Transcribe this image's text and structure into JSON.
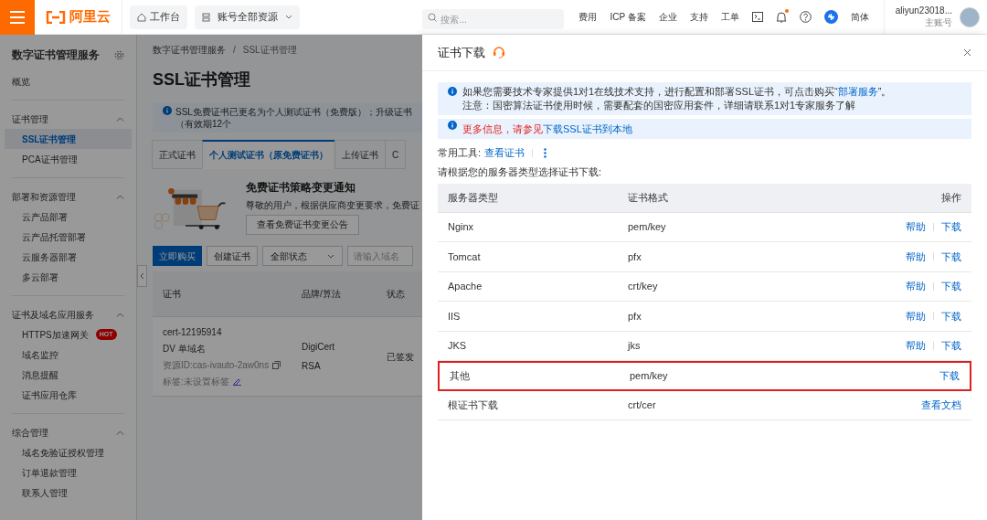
{
  "topbar": {
    "logo": "阿里云",
    "workbench": "工作台",
    "resources": "账号全部资源",
    "search": {
      "placeholder": "搜索..."
    },
    "links": [
      "费用",
      "ICP 备案",
      "企业",
      "支持",
      "工单"
    ],
    "bell_unread": true,
    "language": "简体",
    "user": {
      "name": "aliyun23018...",
      "role": "主账号"
    }
  },
  "sidebar": {
    "title": "数字证书管理服务",
    "items": [
      {
        "label": "概览",
        "selected": false
      }
    ],
    "groups": [
      {
        "label": "证书管理",
        "expanded": true,
        "children": [
          {
            "label": "SSL证书管理",
            "selected": true
          },
          {
            "label": "PCA证书管理",
            "selected": false
          }
        ]
      },
      {
        "label": "部署和资源管理",
        "expanded": true,
        "children": [
          {
            "label": "云产品部署",
            "selected": false
          },
          {
            "label": "云产品托管部署",
            "selected": false
          },
          {
            "label": "云服务器部署",
            "selected": false
          },
          {
            "label": "多云部署",
            "selected": false
          }
        ]
      },
      {
        "label": "证书及域名应用服务",
        "expanded": true,
        "children": [
          {
            "label": "HTTPS加速网关",
            "selected": false,
            "badge": "HOT"
          },
          {
            "label": "域名监控",
            "selected": false
          },
          {
            "label": "消息提醒",
            "selected": false
          },
          {
            "label": "证书应用仓库",
            "selected": false
          }
        ]
      },
      {
        "label": "综合管理",
        "expanded": true,
        "children": [
          {
            "label": "域名免验证授权管理",
            "selected": false
          },
          {
            "label": "订单退款管理",
            "selected": false
          },
          {
            "label": "联系人管理",
            "selected": false
          }
        ]
      }
    ]
  },
  "main": {
    "breadcrumb": [
      "数字证书管理服务",
      "SSL证书管理"
    ],
    "breadcrumb_separator": "/",
    "title": "SSL证书管理",
    "notice": "SSL免费证书已更名为个人测试证书（免费版）；升级证书（有效期12个",
    "tabs": [
      {
        "label": "正式证书",
        "selected": false
      },
      {
        "label": "个人测试证书（原免费证书）",
        "selected": true
      },
      {
        "label": "上传证书",
        "selected": false
      },
      {
        "label": "C",
        "selected": false
      }
    ],
    "promo": {
      "title": "免费证书策略变更通知",
      "text": "尊敬的用户，根据供应商变更要求，免费证",
      "button": "查看免费证书变更公告"
    },
    "toolbar": {
      "buy": "立即购买",
      "create": "创建证书",
      "status": "全部状态",
      "domain_placeholder": "请输入域名"
    },
    "table": {
      "columns": [
        "证书",
        "品牌/算法",
        "状态"
      ],
      "rows": [
        {
          "name": "cert-12195914",
          "type": "DV 单域名",
          "resource": "资源ID:cas-ivauto-2aw0ns",
          "tags": "标签:未设置标签",
          "brand": "DigiCert",
          "algorithm": "RSA",
          "status": "已签发"
        }
      ]
    }
  },
  "drawer": {
    "title": "证书下载",
    "info": [
      {
        "before": "如果您需要技术专家提供1对1在线技术支持，进行配置和部署SSL证书，可点击购买“",
        "link": "部署服务",
        "after": "”。"
      },
      {
        "before": "注意：国密算法证书使用时候，需要配套的国密应用套件，详细请联系1对1专家服务了解"
      }
    ],
    "more": {
      "before": "更多信息，请参见",
      "link": "下载SSL证书到本地"
    },
    "tools": {
      "label": "常用工具:",
      "link": "查看证书"
    },
    "instruction": "请根据您的服务器类型选择证书下载:",
    "table": {
      "columns": [
        "服务器类型",
        "证书格式",
        "操作"
      ],
      "rows": [
        {
          "server": "Nginx",
          "format": "pem/key",
          "actions": [
            "帮助",
            "下载"
          ],
          "highlighted": false
        },
        {
          "server": "Tomcat",
          "format": "pfx",
          "actions": [
            "帮助",
            "下载"
          ],
          "highlighted": false
        },
        {
          "server": "Apache",
          "format": "crt/key",
          "actions": [
            "帮助",
            "下载"
          ],
          "highlighted": false
        },
        {
          "server": "IIS",
          "format": "pfx",
          "actions": [
            "帮助",
            "下载"
          ],
          "highlighted": false
        },
        {
          "server": "JKS",
          "format": "jks",
          "actions": [
            "帮助",
            "下载"
          ],
          "highlighted": false
        },
        {
          "server": "其他",
          "format": "pem/key",
          "actions": [
            "下载"
          ],
          "highlighted": true
        },
        {
          "server": "根证书下载",
          "format": "crt/cer",
          "actions": [
            "查看文档"
          ],
          "highlighted": false
        }
      ]
    }
  }
}
